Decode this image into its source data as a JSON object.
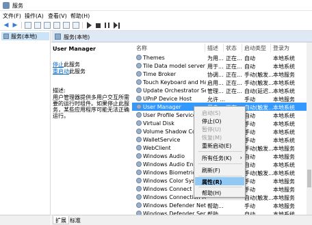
{
  "window": {
    "title": "服务"
  },
  "menu": [
    "文件(F)",
    "操作(A)",
    "查看(V)",
    "帮助(H)"
  ],
  "tree": {
    "item": "服务(本地)"
  },
  "header": {
    "label": "服务(本地)"
  },
  "details": {
    "service_name": "User Manager",
    "stop_link": "停止",
    "stop_suffix": "此服务",
    "restart_link": "重启动",
    "restart_suffix": "此服务",
    "desc_label": "描述:",
    "desc_text": "用户管理器提供多用户交互所需要的运行时组件。如果停止此服务，某些应用程序可能无法正确运行。"
  },
  "columns": {
    "name": "名称",
    "desc": "描述",
    "status": "状态",
    "startup": "启动类型",
    "logon": "登录为"
  },
  "rows": [
    {
      "name": "Themes",
      "c2": "为用...",
      "c3": "正在...",
      "c4": "自动",
      "c5": "本地系统"
    },
    {
      "name": "Tile Data model server",
      "c2": "用于...",
      "c3": "正在...",
      "c4": "自动",
      "c5": "本地系统"
    },
    {
      "name": "Time Broker",
      "c2": "协调...",
      "c3": "正在...",
      "c4": "手动(触发...",
      "c5": "本地服务"
    },
    {
      "name": "Touch Keyboard and Han...",
      "c2": "启用...",
      "c3": "正在...",
      "c4": "手动(触发...",
      "c5": "本地系统"
    },
    {
      "name": "Update Orchestrator Ser...",
      "c2": "管理...",
      "c3": "正在...",
      "c4": "自动(延迟...",
      "c5": "本地系统"
    },
    {
      "name": "UPnP Device Host",
      "c2": "允许 ...",
      "c3": "",
      "c4": "手动",
      "c5": "本地服务"
    },
    {
      "name": "User Manager",
      "c2": "用户...",
      "c3": "正在...",
      "c4": "自动(触发...",
      "c5": "本地系统"
    },
    {
      "name": "User Profile Service",
      "c2": "",
      "c3": "",
      "c4": "自动",
      "c5": "本地系统"
    },
    {
      "name": "Virtual Disk",
      "c2": "",
      "c3": "",
      "c4": "手动",
      "c5": "本地系统"
    },
    {
      "name": "Volume Shadow Copy",
      "c2": "",
      "c3": "",
      "c4": "手动",
      "c5": "本地系统"
    },
    {
      "name": "WalletService",
      "c2": "",
      "c3": "",
      "c4": "手动",
      "c5": "本地系统"
    },
    {
      "name": "WebClient",
      "c2": "",
      "c3": "",
      "c4": "手动(触发...",
      "c5": "本地服务"
    },
    {
      "name": "Windows Audio",
      "c2": "",
      "c3": "",
      "c4": "自动",
      "c5": "本地服务"
    },
    {
      "name": "Windows Audio Endpoint...",
      "c2": "",
      "c3": "",
      "c4": "自动",
      "c5": "本地系统"
    },
    {
      "name": "Windows Biometric Service",
      "c2": "",
      "c3": "",
      "c4": "手动(触发...",
      "c5": "本地系统"
    },
    {
      "name": "Windows Color System",
      "c2": "",
      "c3": "",
      "c4": "手动",
      "c5": "本地服务"
    },
    {
      "name": "Windows Connect Now",
      "c2": "",
      "c3": "",
      "c4": "手动",
      "c5": "本地服务"
    },
    {
      "name": "Windows Connection Ma...",
      "c2": "",
      "c3": "",
      "c4": "自动(触发...",
      "c5": "本地服务"
    },
    {
      "name": "Windows Defender Netw...",
      "c2": "帮助...",
      "c3": "",
      "c4": "手动",
      "c5": "本地服务"
    },
    {
      "name": "Windows Defender Service",
      "c2": "帮助...",
      "c3": "",
      "c4": "自动",
      "c5": "本地系统"
    }
  ],
  "context_menu": {
    "start": "启动(S)",
    "stop": "停止(O)",
    "pause": "暂停(U)",
    "resume": "恢复(M)",
    "restart": "重新启动(E)",
    "all_tasks": "所有任务(K)",
    "refresh": "刷新(F)",
    "properties": "属性(R)",
    "help": "帮助(H)"
  },
  "tabs": {
    "extended": "扩展",
    "standard": "标准"
  }
}
